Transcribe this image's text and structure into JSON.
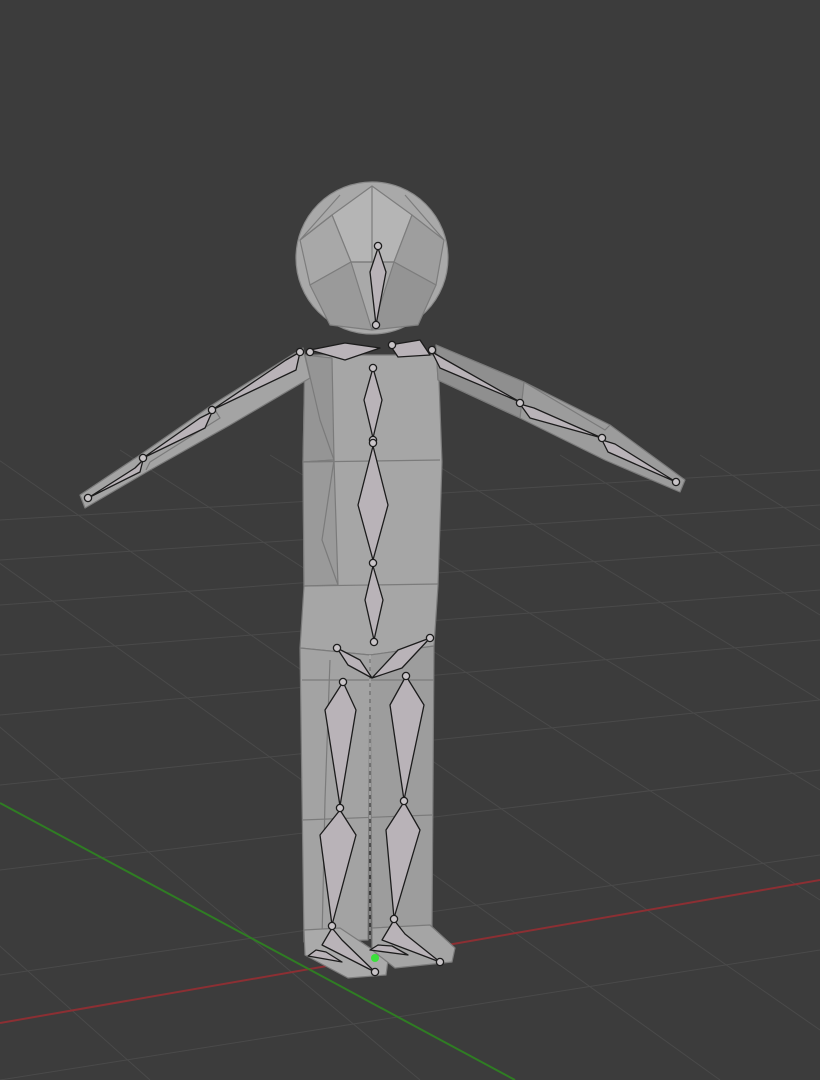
{
  "scene": {
    "view": "3d-viewport",
    "shading": "solid",
    "colors": {
      "background": "#3c3c3c",
      "grid_line": "#4a4a4a",
      "x_axis": "#8c2f33",
      "y_axis": "#2f7d23",
      "mesh_face": "#a3a3a3",
      "mesh_face_dark": "#8f8f8f",
      "mesh_edge": "#7b7b7b",
      "bone_fill": "#b9b3b8",
      "bone_outline": "#1c1c1c",
      "origin_dot": "#3be03b"
    },
    "objects": [
      {
        "type": "mesh",
        "name_shown": false
      },
      {
        "type": "armature",
        "display": "octahedral",
        "name_shown": false
      }
    ]
  }
}
